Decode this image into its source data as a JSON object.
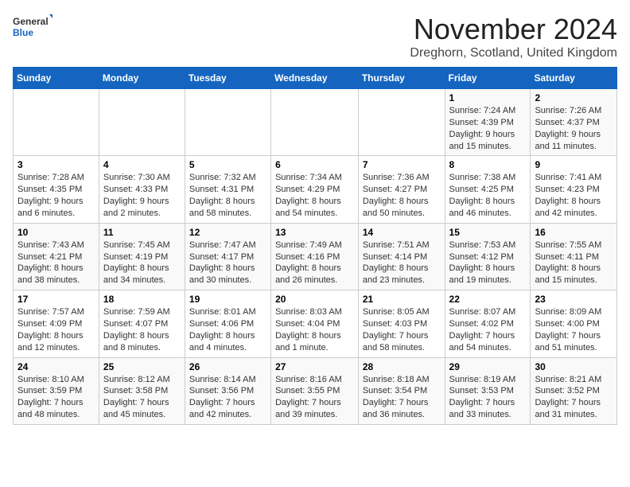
{
  "logo": {
    "general": "General",
    "blue": "Blue"
  },
  "title": "November 2024",
  "location": "Dreghorn, Scotland, United Kingdom",
  "days_of_week": [
    "Sunday",
    "Monday",
    "Tuesday",
    "Wednesday",
    "Thursday",
    "Friday",
    "Saturday"
  ],
  "weeks": [
    [
      {
        "day": "",
        "info": ""
      },
      {
        "day": "",
        "info": ""
      },
      {
        "day": "",
        "info": ""
      },
      {
        "day": "",
        "info": ""
      },
      {
        "day": "",
        "info": ""
      },
      {
        "day": "1",
        "info": "Sunrise: 7:24 AM\nSunset: 4:39 PM\nDaylight: 9 hours and 15 minutes."
      },
      {
        "day": "2",
        "info": "Sunrise: 7:26 AM\nSunset: 4:37 PM\nDaylight: 9 hours and 11 minutes."
      }
    ],
    [
      {
        "day": "3",
        "info": "Sunrise: 7:28 AM\nSunset: 4:35 PM\nDaylight: 9 hours and 6 minutes."
      },
      {
        "day": "4",
        "info": "Sunrise: 7:30 AM\nSunset: 4:33 PM\nDaylight: 9 hours and 2 minutes."
      },
      {
        "day": "5",
        "info": "Sunrise: 7:32 AM\nSunset: 4:31 PM\nDaylight: 8 hours and 58 minutes."
      },
      {
        "day": "6",
        "info": "Sunrise: 7:34 AM\nSunset: 4:29 PM\nDaylight: 8 hours and 54 minutes."
      },
      {
        "day": "7",
        "info": "Sunrise: 7:36 AM\nSunset: 4:27 PM\nDaylight: 8 hours and 50 minutes."
      },
      {
        "day": "8",
        "info": "Sunrise: 7:38 AM\nSunset: 4:25 PM\nDaylight: 8 hours and 46 minutes."
      },
      {
        "day": "9",
        "info": "Sunrise: 7:41 AM\nSunset: 4:23 PM\nDaylight: 8 hours and 42 minutes."
      }
    ],
    [
      {
        "day": "10",
        "info": "Sunrise: 7:43 AM\nSunset: 4:21 PM\nDaylight: 8 hours and 38 minutes."
      },
      {
        "day": "11",
        "info": "Sunrise: 7:45 AM\nSunset: 4:19 PM\nDaylight: 8 hours and 34 minutes."
      },
      {
        "day": "12",
        "info": "Sunrise: 7:47 AM\nSunset: 4:17 PM\nDaylight: 8 hours and 30 minutes."
      },
      {
        "day": "13",
        "info": "Sunrise: 7:49 AM\nSunset: 4:16 PM\nDaylight: 8 hours and 26 minutes."
      },
      {
        "day": "14",
        "info": "Sunrise: 7:51 AM\nSunset: 4:14 PM\nDaylight: 8 hours and 23 minutes."
      },
      {
        "day": "15",
        "info": "Sunrise: 7:53 AM\nSunset: 4:12 PM\nDaylight: 8 hours and 19 minutes."
      },
      {
        "day": "16",
        "info": "Sunrise: 7:55 AM\nSunset: 4:11 PM\nDaylight: 8 hours and 15 minutes."
      }
    ],
    [
      {
        "day": "17",
        "info": "Sunrise: 7:57 AM\nSunset: 4:09 PM\nDaylight: 8 hours and 12 minutes."
      },
      {
        "day": "18",
        "info": "Sunrise: 7:59 AM\nSunset: 4:07 PM\nDaylight: 8 hours and 8 minutes."
      },
      {
        "day": "19",
        "info": "Sunrise: 8:01 AM\nSunset: 4:06 PM\nDaylight: 8 hours and 4 minutes."
      },
      {
        "day": "20",
        "info": "Sunrise: 8:03 AM\nSunset: 4:04 PM\nDaylight: 8 hours and 1 minute."
      },
      {
        "day": "21",
        "info": "Sunrise: 8:05 AM\nSunset: 4:03 PM\nDaylight: 7 hours and 58 minutes."
      },
      {
        "day": "22",
        "info": "Sunrise: 8:07 AM\nSunset: 4:02 PM\nDaylight: 7 hours and 54 minutes."
      },
      {
        "day": "23",
        "info": "Sunrise: 8:09 AM\nSunset: 4:00 PM\nDaylight: 7 hours and 51 minutes."
      }
    ],
    [
      {
        "day": "24",
        "info": "Sunrise: 8:10 AM\nSunset: 3:59 PM\nDaylight: 7 hours and 48 minutes."
      },
      {
        "day": "25",
        "info": "Sunrise: 8:12 AM\nSunset: 3:58 PM\nDaylight: 7 hours and 45 minutes."
      },
      {
        "day": "26",
        "info": "Sunrise: 8:14 AM\nSunset: 3:56 PM\nDaylight: 7 hours and 42 minutes."
      },
      {
        "day": "27",
        "info": "Sunrise: 8:16 AM\nSunset: 3:55 PM\nDaylight: 7 hours and 39 minutes."
      },
      {
        "day": "28",
        "info": "Sunrise: 8:18 AM\nSunset: 3:54 PM\nDaylight: 7 hours and 36 minutes."
      },
      {
        "day": "29",
        "info": "Sunrise: 8:19 AM\nSunset: 3:53 PM\nDaylight: 7 hours and 33 minutes."
      },
      {
        "day": "30",
        "info": "Sunrise: 8:21 AM\nSunset: 3:52 PM\nDaylight: 7 hours and 31 minutes."
      }
    ]
  ]
}
